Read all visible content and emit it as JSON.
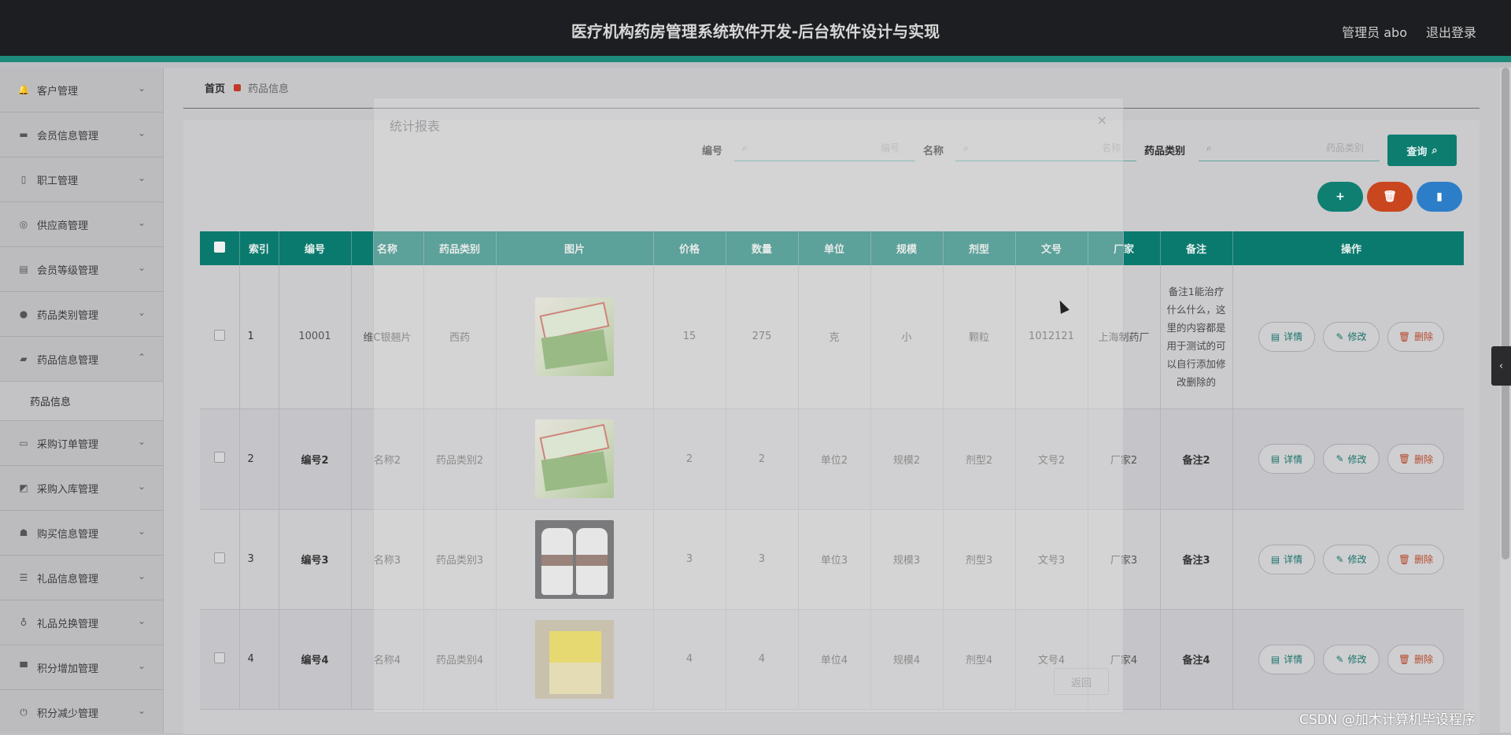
{
  "header": {
    "title": "医疗机构药房管理系统软件开发-后台软件设计与实现",
    "user": "管理员 abo",
    "logout": "退出登录"
  },
  "sidebar": {
    "items": [
      {
        "label": "客户管理",
        "icon": "bell-icon"
      },
      {
        "label": "会员信息管理",
        "icon": "briefcase-icon"
      },
      {
        "label": "职工管理",
        "icon": "mobile-icon"
      },
      {
        "label": "供应商管理",
        "icon": "compass-icon"
      },
      {
        "label": "会员等级管理",
        "icon": "clipboard-icon"
      },
      {
        "label": "药品类别管理",
        "icon": "bulb-icon"
      },
      {
        "label": "药品信息管理",
        "icon": "ticket-icon",
        "expanded": true
      },
      {
        "label": "采购订单管理",
        "icon": "monitor-icon"
      },
      {
        "label": "采购入库管理",
        "icon": "chart-icon"
      },
      {
        "label": "购买信息管理",
        "icon": "user-icon"
      },
      {
        "label": "礼品信息管理",
        "icon": "sliders-icon"
      },
      {
        "label": "礼品兑换管理",
        "icon": "mic-icon"
      },
      {
        "label": "积分增加管理",
        "icon": "hammer-icon"
      },
      {
        "label": "积分减少管理",
        "icon": "power-icon"
      }
    ],
    "sub_item": "药品信息"
  },
  "breadcrumb": {
    "home": "首页",
    "current": "药品信息"
  },
  "search": {
    "code_label": "编号",
    "code_placeholder": "编号",
    "name_label": "名称",
    "name_placeholder": "名称",
    "category_label": "药品类别",
    "category_placeholder": "药品类别",
    "query_button": "查询"
  },
  "actions": {
    "add": "+",
    "delete": "🗑",
    "stats": "▮"
  },
  "table": {
    "headers": [
      "索引",
      "编号",
      "名称",
      "药品类别",
      "图片",
      "价格",
      "数量",
      "单位",
      "规模",
      "剂型",
      "文号",
      "厂家",
      "备注",
      "操作"
    ],
    "rows": [
      {
        "index": "1",
        "code": "10001",
        "name": "维C银翘片",
        "category": "西药",
        "price": "15",
        "qty": "275",
        "unit": "克",
        "scale": "小",
        "form": "颗粒",
        "number": "1012121",
        "maker": "上海制药厂",
        "remark": "备注1能治疗什么什么，这里的内容都是用于测试的可以自行添加修改删除的"
      },
      {
        "index": "2",
        "code": "编号2",
        "name": "名称2",
        "category": "药品类别2",
        "price": "2",
        "qty": "2",
        "unit": "单位2",
        "scale": "规模2",
        "form": "剂型2",
        "number": "文号2",
        "maker": "厂家2",
        "remark": "备注2"
      },
      {
        "index": "3",
        "code": "编号3",
        "name": "名称3",
        "category": "药品类别3",
        "price": "3",
        "qty": "3",
        "unit": "单位3",
        "scale": "规模3",
        "form": "剂型3",
        "number": "文号3",
        "maker": "厂家3",
        "remark": "备注3"
      },
      {
        "index": "4",
        "code": "编号4",
        "name": "名称4",
        "category": "药品类别4",
        "price": "4",
        "qty": "4",
        "unit": "单位4",
        "scale": "规模4",
        "form": "剂型4",
        "number": "文号4",
        "maker": "厂家4",
        "remark": "备注4"
      }
    ],
    "op_detail": "详情",
    "op_edit": "修改",
    "op_delete": "删除"
  },
  "modal": {
    "title": "统计报表",
    "close": "×",
    "back_button": "返回"
  },
  "watermark": "CSDN @加木计算机毕设程序",
  "colors": {
    "accent": "#0b7a6e",
    "danger": "#c9461f",
    "info": "#2d7ec9",
    "topbar": "#1d1e21"
  }
}
